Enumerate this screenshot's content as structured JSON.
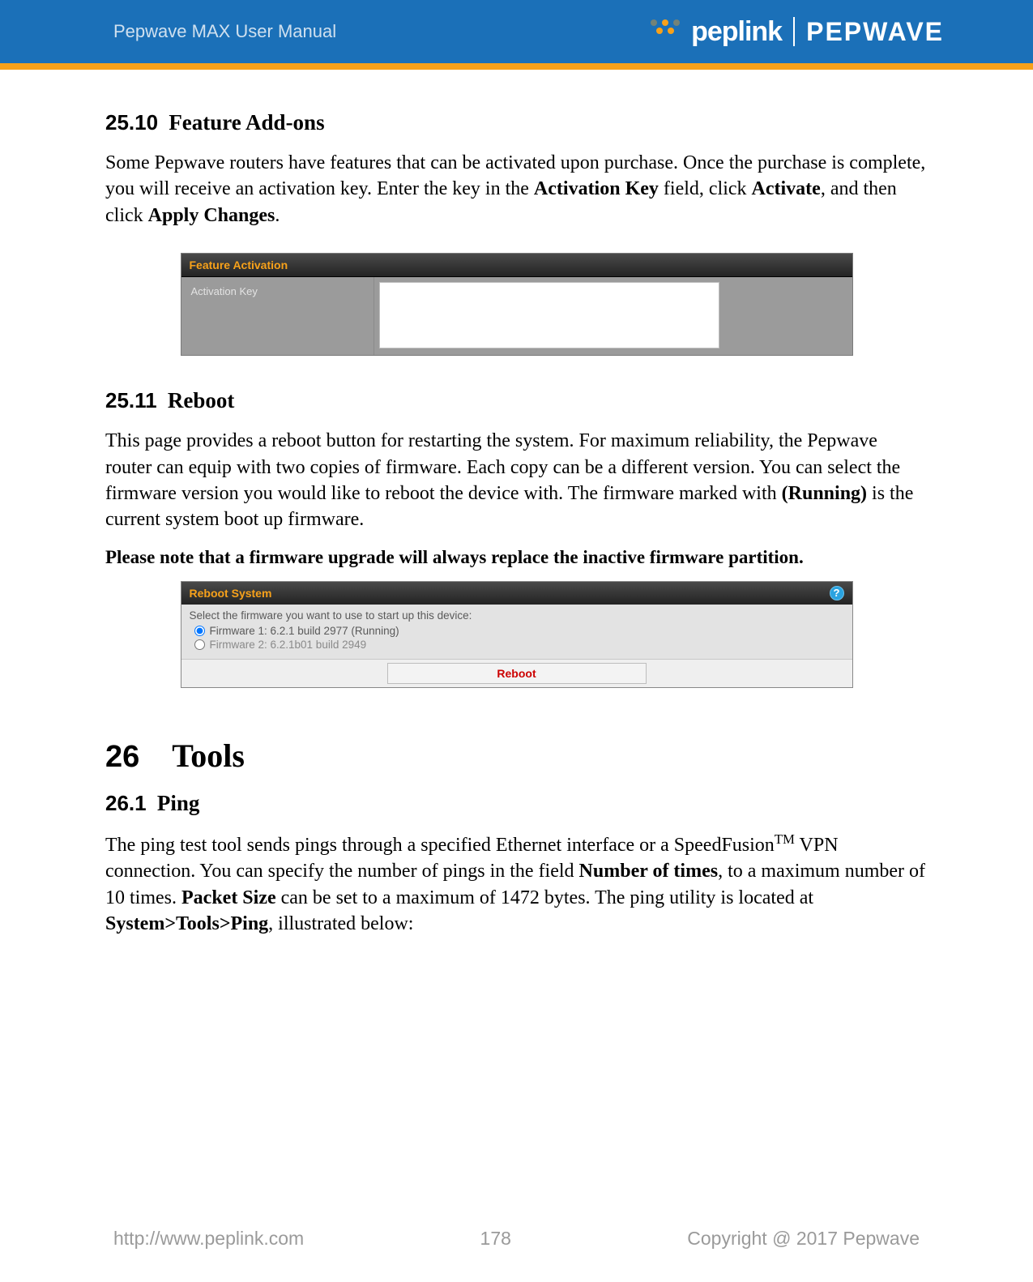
{
  "header": {
    "manual_title": "Pepwave MAX User Manual",
    "brand_left": "peplink",
    "brand_right": "PEPWAVE"
  },
  "sections": {
    "s25_10": {
      "num": "25.10",
      "title": "Feature Add-ons",
      "para_parts": [
        "Some Pepwave routers have features that can be activated upon purchase. Once the purchase is complete, you will receive an activation key. Enter the key in the ",
        "Activation Key",
        " field, click ",
        "Activate",
        ", and then click ",
        "Apply Changes",
        "."
      ]
    },
    "feature_activation": {
      "panel_title": "Feature Activation",
      "label": "Activation Key",
      "value": ""
    },
    "s25_11": {
      "num": "25.11",
      "title": "Reboot",
      "para_parts": [
        "This page provides a reboot button for restarting the system. For maximum reliability, the Pepwave router can equip with two copies of firmware. Each copy can be a different version. You can select the firmware version you would like to reboot the device with. The firmware marked with ",
        "(Running)",
        " is the current system boot up firmware."
      ],
      "note": "Please note that a firmware upgrade will always replace the inactive firmware partition."
    },
    "reboot_system": {
      "panel_title": "Reboot System",
      "help_glyph": "?",
      "instruction": "Select the firmware you want to use to start up this device:",
      "options": [
        {
          "label": "Firmware 1: 6.2.1 build 2977 (Running)",
          "checked": true
        },
        {
          "label": "Firmware 2: 6.2.1b01 build 2949",
          "checked": false
        }
      ],
      "button": "Reboot"
    },
    "s26": {
      "num": "26",
      "title": "Tools"
    },
    "s26_1": {
      "num": "26.1",
      "title": "Ping",
      "para_parts": [
        "The ping test tool sends pings through a specified Ethernet interface or a SpeedFusion",
        "TM",
        " VPN connection. You can specify the number of pings in the field ",
        "Number of times",
        ", to a maximum number of 10 times. ",
        "Packet Size",
        " can be set to a maximum of 1472 bytes. The ping utility is located at ",
        "System>Tools>Ping",
        ", illustrated below:"
      ]
    }
  },
  "footer": {
    "url": "http://www.peplink.com",
    "page": "178",
    "copyright": "Copyright @ 2017 Pepwave"
  }
}
